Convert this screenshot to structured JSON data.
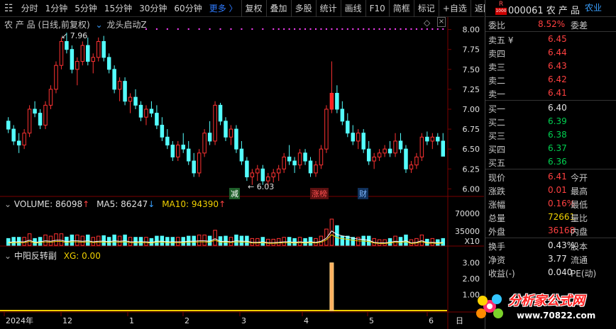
{
  "toolbar": {
    "items": [
      "分时",
      "1分钟",
      "5分钟",
      "15分钟",
      "30分钟",
      "60分钟",
      "更多 〉",
      "复权",
      "叠加",
      "多股",
      "统计",
      "画线",
      "F10",
      "简框",
      "标记",
      "+自选",
      "返回"
    ]
  },
  "chart": {
    "title": "农 产 品 (日线,前复权)",
    "indicator_name": "龙头启动Z",
    "price_ticks": [
      "8.00",
      "7.75",
      "7.50",
      "7.25",
      "7.00",
      "6.75",
      "6.50",
      "6.25",
      "6.00"
    ],
    "high_label": "7.96",
    "low_label": "6.03",
    "event_tags": [
      "减",
      "涨榜",
      "财"
    ],
    "volume_label": "VOLUME: 86098",
    "ma5_label": "MA5: 86247",
    "ma10_label": "MA10: 94390",
    "vol_ticks": [
      "70000",
      "35000",
      "X10"
    ],
    "sub_label": "中阳反转副",
    "xg_label": "XG: 0.00",
    "sub_ticks": [
      "3.00",
      "2.00",
      "1.00"
    ],
    "x_axis": [
      "2024年",
      "12",
      "1",
      "2",
      "3",
      "4",
      "5",
      "6"
    ],
    "axis_corner": "日"
  },
  "quote": {
    "badge": "R",
    "code_name": "000061 农 产 品",
    "industry": "农业",
    "weibi_label": "委比",
    "weibi_value": "8.52%",
    "weicha_label": "委差",
    "asks": [
      {
        "label": "卖五 ¥",
        "price": "6.45"
      },
      {
        "label": "卖四",
        "price": "6.44"
      },
      {
        "label": "卖三",
        "price": "6.43"
      },
      {
        "label": "卖二",
        "price": "6.42"
      },
      {
        "label": "卖一",
        "price": "6.41"
      }
    ],
    "bids": [
      {
        "label": "买一",
        "price": "6.40"
      },
      {
        "label": "买二",
        "price": "6.39"
      },
      {
        "label": "买三",
        "price": "6.38"
      },
      {
        "label": "买四",
        "price": "6.37"
      },
      {
        "label": "买五",
        "price": "6.36"
      }
    ],
    "stats": [
      {
        "l": "现价",
        "v": "6.41",
        "r": "今开"
      },
      {
        "l": "涨跌",
        "v": "0.01",
        "r": "最高"
      },
      {
        "l": "涨幅",
        "v": "0.16%",
        "r": "最低"
      },
      {
        "l": "总量",
        "v": "72661",
        "r": "量比"
      },
      {
        "l": "外盘",
        "v": "36168",
        "r": "内盘"
      }
    ],
    "stats2": [
      {
        "l": "换手",
        "v": "0.43%",
        "r": "股本"
      },
      {
        "l": "净资",
        "v": "3.77",
        "r": "流通"
      },
      {
        "l": "收益(-)",
        "v": "0.040",
        "r": "PE(动)"
      }
    ]
  },
  "watermark": {
    "text": "分析家公式网",
    "url": "www.70822.com"
  },
  "chart_data": {
    "type": "candlestick",
    "ylim": [
      5.95,
      8.05
    ],
    "candles": [
      [
        6.85,
        6.9,
        6.7,
        6.75
      ],
      [
        6.75,
        6.8,
        6.55,
        6.6
      ],
      [
        6.6,
        6.7,
        6.45,
        6.55
      ],
      [
        6.55,
        6.75,
        6.5,
        6.7
      ],
      [
        6.7,
        7.05,
        6.65,
        7.0
      ],
      [
        7.0,
        7.1,
        6.9,
        6.95
      ],
      [
        6.95,
        7.0,
        6.75,
        6.8
      ],
      [
        6.8,
        7.1,
        6.75,
        7.05
      ],
      [
        7.05,
        7.3,
        7.0,
        7.25
      ],
      [
        7.25,
        7.6,
        7.2,
        7.55
      ],
      [
        7.55,
        7.9,
        7.5,
        7.85
      ],
      [
        7.85,
        7.96,
        7.7,
        7.75
      ],
      [
        7.75,
        7.8,
        7.45,
        7.5
      ],
      [
        7.5,
        7.65,
        7.3,
        7.6
      ],
      [
        7.6,
        7.85,
        7.55,
        7.8
      ],
      [
        7.8,
        7.9,
        7.55,
        7.6
      ],
      [
        7.6,
        7.7,
        7.45,
        7.65
      ],
      [
        7.65,
        7.9,
        7.6,
        7.85
      ],
      [
        7.85,
        7.92,
        7.6,
        7.65
      ],
      [
        7.65,
        7.7,
        7.45,
        7.5
      ],
      [
        7.5,
        7.55,
        7.2,
        7.25
      ],
      [
        7.25,
        7.4,
        7.1,
        7.35
      ],
      [
        7.35,
        7.4,
        7.05,
        7.1
      ],
      [
        7.1,
        7.2,
        6.95,
        7.15
      ],
      [
        7.15,
        7.25,
        7.0,
        7.05
      ],
      [
        7.05,
        7.1,
        6.85,
        6.9
      ],
      [
        6.9,
        7.05,
        6.8,
        7.0
      ],
      [
        7.0,
        7.1,
        6.9,
        6.95
      ],
      [
        6.95,
        7.05,
        6.75,
        6.8
      ],
      [
        6.8,
        6.9,
        6.6,
        6.65
      ],
      [
        6.65,
        6.75,
        6.5,
        6.55
      ],
      [
        6.55,
        6.6,
        6.35,
        6.4
      ],
      [
        6.4,
        6.6,
        6.35,
        6.55
      ],
      [
        6.55,
        6.7,
        6.45,
        6.5
      ],
      [
        6.5,
        6.6,
        6.3,
        6.35
      ],
      [
        6.35,
        6.45,
        6.15,
        6.2
      ],
      [
        6.2,
        6.5,
        6.15,
        6.45
      ],
      [
        6.45,
        6.75,
        6.4,
        6.7
      ],
      [
        6.7,
        6.85,
        6.55,
        6.6
      ],
      [
        6.6,
        7.1,
        6.55,
        7.05
      ],
      [
        7.05,
        7.08,
        6.8,
        6.85
      ],
      [
        6.85,
        6.9,
        6.6,
        6.65
      ],
      [
        6.65,
        6.8,
        6.55,
        6.75
      ],
      [
        6.75,
        6.8,
        6.45,
        6.5
      ],
      [
        6.5,
        6.6,
        6.3,
        6.35
      ],
      [
        6.35,
        6.4,
        6.1,
        6.15
      ],
      [
        6.15,
        6.25,
        6.05,
        6.2
      ],
      [
        6.2,
        6.3,
        6.1,
        6.25
      ],
      [
        6.25,
        6.3,
        6.05,
        6.1
      ],
      [
        6.1,
        6.2,
        6.03,
        6.15
      ],
      [
        6.15,
        6.25,
        6.08,
        6.2
      ],
      [
        6.2,
        6.3,
        6.1,
        6.25
      ],
      [
        6.25,
        6.45,
        6.2,
        6.4
      ],
      [
        6.4,
        6.55,
        6.3,
        6.35
      ],
      [
        6.35,
        6.4,
        6.2,
        6.3
      ],
      [
        6.3,
        6.5,
        6.25,
        6.45
      ],
      [
        6.45,
        6.5,
        6.3,
        6.35
      ],
      [
        6.35,
        6.4,
        6.15,
        6.2
      ],
      [
        6.2,
        6.35,
        6.15,
        6.3
      ],
      [
        6.3,
        6.55,
        6.25,
        6.5
      ],
      [
        6.5,
        7.05,
        6.45,
        7.0
      ],
      [
        7.0,
        7.6,
        6.95,
        7.2
      ],
      [
        7.2,
        7.3,
        6.95,
        7.0
      ],
      [
        7.0,
        7.1,
        6.8,
        6.85
      ],
      [
        6.85,
        6.95,
        6.65,
        6.7
      ],
      [
        6.7,
        6.8,
        6.55,
        6.6
      ],
      [
        6.6,
        6.75,
        6.5,
        6.7
      ],
      [
        6.7,
        6.75,
        6.45,
        6.5
      ],
      [
        6.5,
        6.6,
        6.3,
        6.35
      ],
      [
        6.35,
        6.45,
        6.25,
        6.4
      ],
      [
        6.4,
        6.5,
        6.35,
        6.45
      ],
      [
        6.45,
        6.55,
        6.4,
        6.5
      ],
      [
        6.5,
        6.6,
        6.4,
        6.45
      ],
      [
        6.45,
        6.7,
        6.4,
        6.6
      ],
      [
        6.6,
        6.7,
        6.45,
        6.5
      ],
      [
        6.5,
        6.55,
        6.2,
        6.25
      ],
      [
        6.25,
        6.35,
        6.2,
        6.3
      ],
      [
        6.3,
        6.45,
        6.25,
        6.4
      ],
      [
        6.4,
        6.7,
        6.35,
        6.65
      ],
      [
        6.65,
        6.72,
        6.55,
        6.6
      ],
      [
        6.6,
        6.7,
        6.5,
        6.65
      ],
      [
        6.65,
        6.7,
        6.55,
        6.6
      ],
      [
        6.6,
        6.7,
        6.5,
        6.41
      ]
    ],
    "volume_spike_index": 61,
    "signal_index": 61,
    "signal_value": 3.0
  }
}
